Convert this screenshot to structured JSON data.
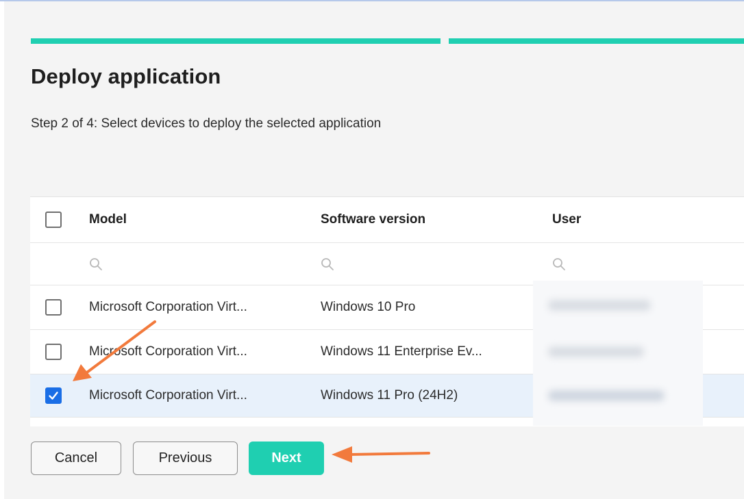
{
  "dialog": {
    "title": "Deploy application",
    "subtitle": "Step 2 of 4: Select devices to deploy the selected application",
    "progress_steps_completed": 2,
    "accent_color": "#1fcfb1"
  },
  "table": {
    "columns": [
      "Model",
      "Software version",
      "User"
    ],
    "rows": [
      {
        "model": "Microsoft Corporation Virt...",
        "software": "Windows 10 Pro",
        "checked": false
      },
      {
        "model": "Microsoft Corporation Virt...",
        "software": "Windows 11 Enterprise Ev...",
        "checked": false
      },
      {
        "model": "Microsoft Corporation Virt...",
        "software": "Windows 11 Pro (24H2)",
        "checked": true
      }
    ]
  },
  "buttons": {
    "cancel": "Cancel",
    "previous": "Previous",
    "next": "Next"
  },
  "icons": {
    "filter": "search-icon",
    "annotation": "arrow-icon"
  }
}
